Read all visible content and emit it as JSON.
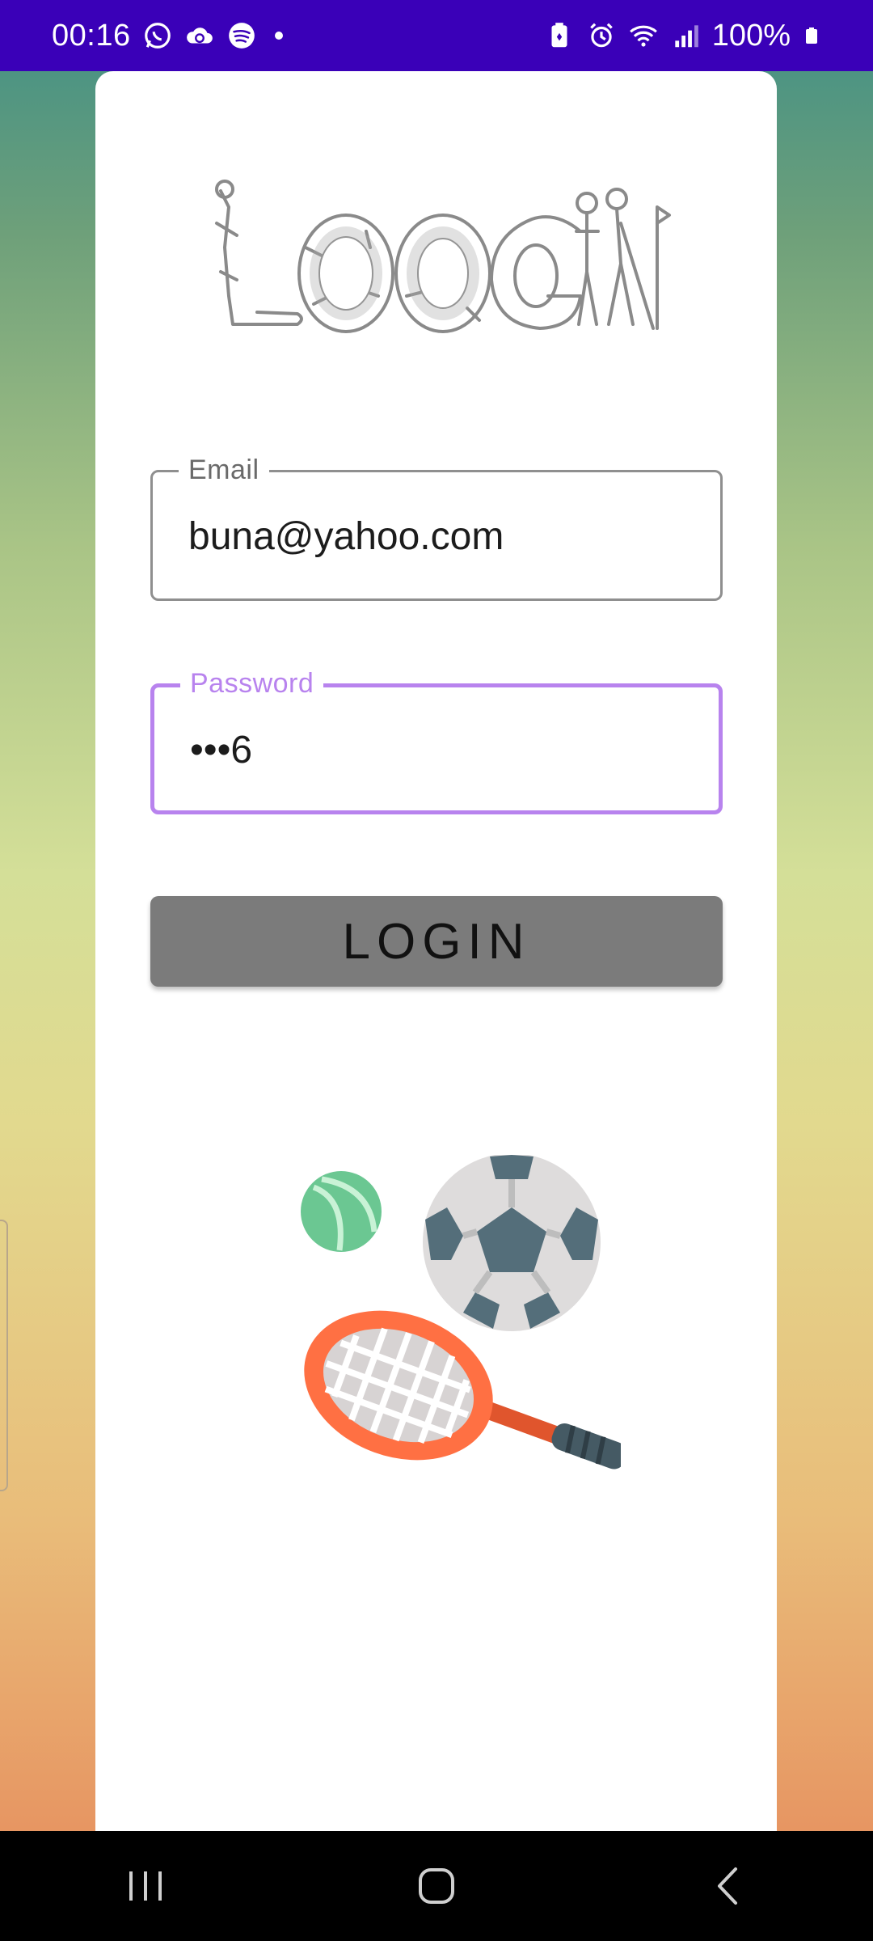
{
  "status_bar": {
    "time": "00:16",
    "battery": "100%",
    "left_icons": [
      "whatsapp-icon",
      "cloud-sync-icon",
      "spotify-icon",
      "notification-dot"
    ],
    "right_icons": [
      "battery-saver-icon",
      "alarm-icon",
      "wifi-icon",
      "signal-icon",
      "battery-icon"
    ],
    "color": "#3a00b8"
  },
  "logo": {
    "text": "LOGIN",
    "style": "sports-figures illustration"
  },
  "form": {
    "email": {
      "label": "Email",
      "value": "buna@yahoo.com"
    },
    "password": {
      "label": "Password",
      "value": "•••6",
      "focused": true,
      "accent_color": "#b883ee"
    },
    "login_button": "LOGIN"
  },
  "illustration": {
    "items": [
      "tennis-ball-icon",
      "soccer-ball-icon",
      "tennis-racket-icon"
    ]
  },
  "nav_bar": {
    "buttons": [
      "recent-apps",
      "home",
      "back"
    ]
  }
}
